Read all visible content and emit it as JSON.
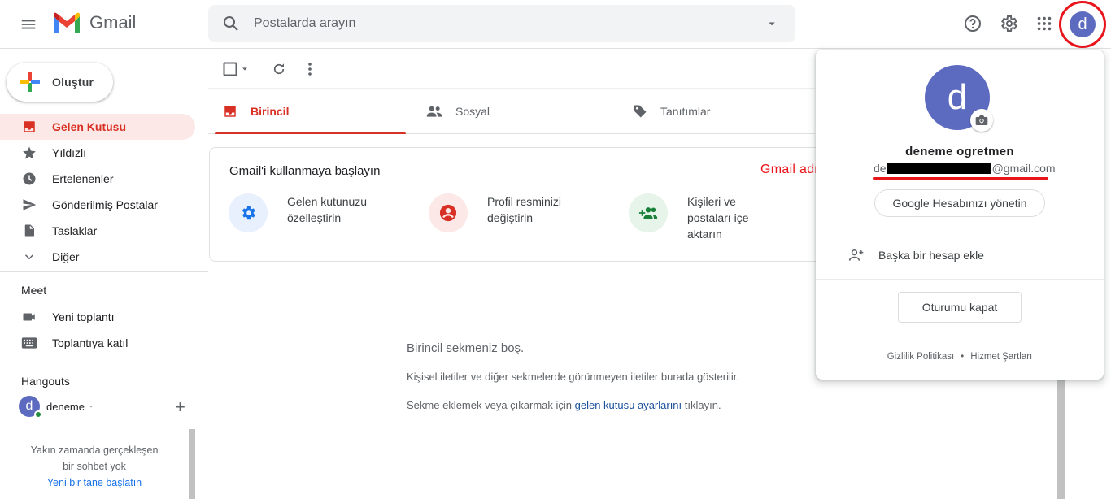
{
  "header": {
    "app_name": "Gmail",
    "search_placeholder": "Postalarda arayın",
    "account_initial": "d"
  },
  "sidebar": {
    "compose_label": "Oluştur",
    "items": [
      {
        "label": "Gelen Kutusu",
        "icon": "inbox-icon",
        "active": true
      },
      {
        "label": "Yıldızlı",
        "icon": "star-icon"
      },
      {
        "label": "Ertelenenler",
        "icon": "clock-icon"
      },
      {
        "label": "Gönderilmiş Postalar",
        "icon": "send-icon"
      },
      {
        "label": "Taslaklar",
        "icon": "draft-icon"
      },
      {
        "label": "Diğer",
        "icon": "chevron-down-icon"
      }
    ],
    "meet": {
      "title": "Meet",
      "items": [
        {
          "label": "Yeni toplantı",
          "icon": "video-icon"
        },
        {
          "label": "Toplantıya katıl",
          "icon": "keyboard-icon"
        }
      ]
    },
    "hangouts": {
      "title": "Hangouts",
      "user_name": "deneme",
      "user_initial": "d",
      "empty_text": "Yakın zamanda gerçekleşen bir sohbet yok",
      "start_link": "Yeni bir tane başlatın"
    }
  },
  "tabs": [
    {
      "label": "Birincil",
      "icon": "inbox-icon",
      "active": true
    },
    {
      "label": "Sosyal",
      "icon": "people-icon"
    },
    {
      "label": "Tanıtımlar",
      "icon": "tag-icon"
    }
  ],
  "getting_started": {
    "title": "Gmail'i kullanmaya başlayın",
    "items": [
      {
        "line1": "Gelen kutunuzu",
        "line2": "özelleştirin",
        "line3": "",
        "icon": "gear-icon",
        "color": "#1a73e8",
        "bg": "#e8f0fe"
      },
      {
        "line1": "Profil resminizi",
        "line2": "değiştirin",
        "line3": "",
        "icon": "account-circle-icon",
        "color": "#d93025",
        "bg": "#fce8e6"
      },
      {
        "line1": "Kişileri ve",
        "line2": "postaları içe",
        "line3": "aktarın",
        "icon": "group-add-icon",
        "color": "#188038",
        "bg": "#e6f4ea"
      }
    ]
  },
  "empty_state": {
    "title": "Birincil sekmeniz boş.",
    "line1": "Kişisel iletiler ve diğer sekmelerde görünmeyen iletiler burada gösterilir.",
    "line2_prefix": "Sekme eklemek veya çıkarmak için ",
    "line2_link": "gelen kutusu ayarlarını",
    "line2_suffix": " tıklayın."
  },
  "account_popup": {
    "initial": "d",
    "name": "deneme ogretmen",
    "email_prefix": "de",
    "email_suffix": "@gmail.com",
    "manage_label": "Google Hesabınızı yönetin",
    "add_account_label": "Başka bir hesap ekle",
    "sign_out_label": "Oturumu kapat",
    "privacy_label": "Gizlilik Politikası",
    "separator": "•",
    "terms_label": "Hizmet Şartları"
  },
  "annotation": {
    "text": "Gmail adresiniz:",
    "color": "#e8151b"
  },
  "colors": {
    "accent": "#d93025",
    "avatar": "#5c6bc0",
    "link": "#1a73e8"
  }
}
